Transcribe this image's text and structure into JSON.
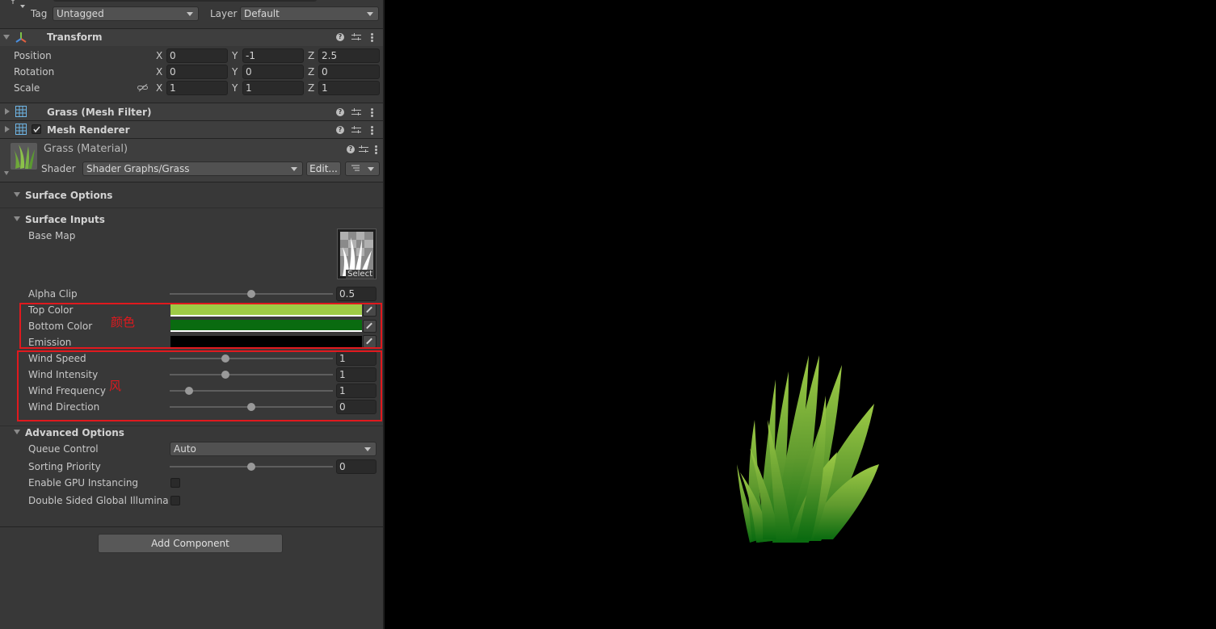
{
  "header": {
    "tag_label": "Tag",
    "tag_value": "Untagged",
    "layer_label": "Layer",
    "layer_value": "Default"
  },
  "transform": {
    "title": "Transform",
    "position_label": "Position",
    "rotation_label": "Rotation",
    "scale_label": "Scale",
    "axis_x": "X",
    "axis_y": "Y",
    "axis_z": "Z",
    "position": {
      "x": "0",
      "y": "-1",
      "z": "2.5"
    },
    "rotation": {
      "x": "0",
      "y": "0",
      "z": "0"
    },
    "scale": {
      "x": "1",
      "y": "1",
      "z": "1"
    }
  },
  "components": {
    "mesh_filter": "Grass (Mesh Filter)",
    "mesh_renderer": "Mesh Renderer"
  },
  "material": {
    "name": "Grass (Material)",
    "shader_label": "Shader",
    "shader_value": "Shader Graphs/Grass",
    "edit_label": "Edit..."
  },
  "surface_options": {
    "title": "Surface Options"
  },
  "surface_inputs": {
    "title": "Surface Inputs",
    "base_map_label": "Base Map",
    "select_label": "Select",
    "alpha_clip": {
      "label": "Alpha Clip",
      "value": "0.5",
      "fraction": 0.5
    },
    "top_color": {
      "label": "Top Color",
      "color": "#9ecb46"
    },
    "bottom_color": {
      "label": "Bottom Color",
      "color": "#0a6b10"
    },
    "emission": {
      "label": "Emission",
      "color": "#000000"
    },
    "wind_speed": {
      "label": "Wind Speed",
      "value": "1",
      "fraction": 0.34
    },
    "wind_intensity": {
      "label": "Wind Intensity",
      "value": "1",
      "fraction": 0.34
    },
    "wind_frequency": {
      "label": "Wind Frequency",
      "value": "1",
      "fraction": 0.12
    },
    "wind_direction": {
      "label": "Wind Direction",
      "value": "0",
      "fraction": 0.5
    }
  },
  "annotations": {
    "color_note": "颜色",
    "wind_note": "风",
    "accent": "#e0191e"
  },
  "advanced_options": {
    "title": "Advanced Options",
    "queue_control_label": "Queue Control",
    "queue_control_value": "Auto",
    "sorting_priority": {
      "label": "Sorting Priority",
      "value": "0",
      "fraction": 0.5
    },
    "gpu_instancing_label": "Enable GPU Instancing",
    "double_sided_gi_label": "Double Sided Global Illuminatio"
  },
  "add_component_label": "Add Component"
}
